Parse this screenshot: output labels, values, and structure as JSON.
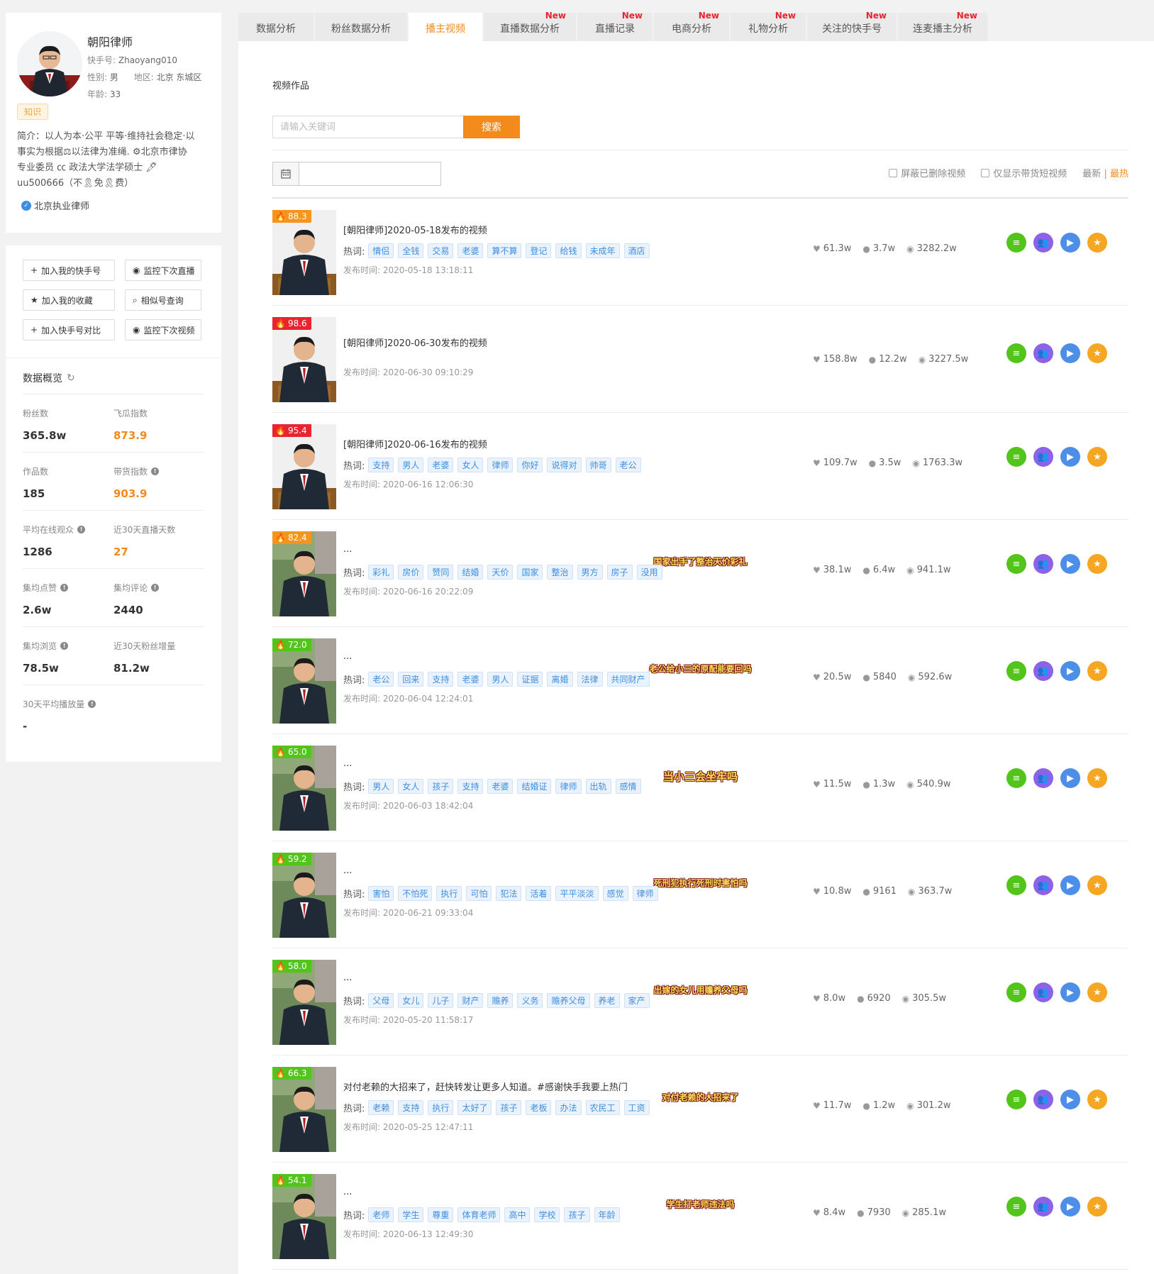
{
  "profile": {
    "name": "朝阳律师",
    "account_label": "快手号:",
    "account": "Zhaoyang010",
    "gender_label": "性别:",
    "gender": "男",
    "region_label": "地区:",
    "region": "北京 东城区",
    "age_label": "年龄:",
    "age": "33",
    "category": "知识",
    "bio_1": "简介：以人为本·公平 平等·维持社会稳定·以",
    "bio_2": "事实为根据⚖以法律为准绳. ⚙北京市律协",
    "bio_3": "专业委员 ㏄ 政法大学法学硕士 🖊",
    "bio_4": "uu500666（不🎗免🎗费）",
    "verified": "北京执业律师"
  },
  "actions": {
    "add_mine": "加入我的快手号",
    "monitor_live": "监控下次直播",
    "add_fav": "加入我的收藏",
    "similar": "相似号查询",
    "add_compare": "加入快手号对比",
    "monitor_video": "监控下次视频"
  },
  "overview": {
    "title": "数据概览",
    "fans_label": "粉丝数",
    "fans": "365.8w",
    "feigua_label": "飞瓜指数",
    "feigua": "873.9",
    "works_label": "作品数",
    "works": "185",
    "goods_label": "带货指数",
    "goods": "903.9",
    "online_label": "平均在线观众",
    "online": "1286",
    "livedays_label": "近30天直播天数",
    "livedays": "27",
    "avg_like_label": "集均点赞",
    "avg_like": "2.6w",
    "avg_comment_label": "集均评论",
    "avg_comment": "2440",
    "avg_view_label": "集均浏览",
    "avg_view": "78.5w",
    "fans_growth_label": "近30天粉丝增量",
    "fans_growth": "81.2w",
    "avg_play_label": "30天平均播放量",
    "avg_play": "-"
  },
  "tabs": [
    {
      "label": "数据分析",
      "new": ""
    },
    {
      "label": "粉丝数据分析",
      "new": ""
    },
    {
      "label": "播主视频",
      "new": ""
    },
    {
      "label": "直播数据分析",
      "new": "New"
    },
    {
      "label": "直播记录",
      "new": "New"
    },
    {
      "label": "电商分析",
      "new": "New"
    },
    {
      "label": "礼物分析",
      "new": "New"
    },
    {
      "label": "关注的快手号",
      "new": "New"
    },
    {
      "label": "连麦播主分析",
      "new": "New"
    }
  ],
  "main": {
    "section_title": "视频作品",
    "search_placeholder": "请输入关键词",
    "search_button": "搜索",
    "filter_deleted": "屏蔽已删除视频",
    "filter_goods": "仅显示带货短视频",
    "sort_latest": "最新",
    "sort_sep": "|",
    "sort_hot": "最热",
    "hot_label": "热词:",
    "time_label": "发布时间:"
  },
  "colors": {
    "accent": "#f28a1c",
    "score_orange": "#f7941d",
    "score_red": "#e8252e",
    "score_green": "#52c41a"
  },
  "videos": [
    {
      "score": "88.3",
      "title": "[朝阳律师]2020-05-18发布的视频",
      "tags": [
        "情侣",
        "全钱",
        "交易",
        "老婆",
        "算不算",
        "登记",
        "给钱",
        "未成年",
        "酒店"
      ],
      "time": "2020-05-18 13:18:11",
      "likes": "61.3w",
      "comments": "3.7w",
      "views": "3282.2w",
      "cover": ""
    },
    {
      "score": "98.6",
      "title": "[朝阳律师]2020-06-30发布的视频",
      "tags": [],
      "time": "2020-06-30 09:10:29",
      "likes": "158.8w",
      "comments": "12.2w",
      "views": "3227.5w",
      "cover": ""
    },
    {
      "score": "95.4",
      "title": "[朝阳律师]2020-06-16发布的视频",
      "tags": [
        "支持",
        "男人",
        "老婆",
        "女人",
        "律师",
        "你好",
        "说得对",
        "帅哥",
        "老公"
      ],
      "time": "2020-06-16 12:06:30",
      "likes": "109.7w",
      "comments": "3.5w",
      "views": "1763.3w",
      "cover": ""
    },
    {
      "score": "82.4",
      "title": "...",
      "tags": [
        "彩礼",
        "房价",
        "赞同",
        "结婚",
        "天价",
        "国家",
        "整治",
        "男方",
        "房子",
        "没用"
      ],
      "time": "2020-06-16 20:22:09",
      "likes": "38.1w",
      "comments": "6.4w",
      "views": "941.1w",
      "cover": "国家出手了整治天价彩礼"
    },
    {
      "score": "72.0",
      "title": "...",
      "tags": [
        "老公",
        "回来",
        "支持",
        "老婆",
        "男人",
        "证据",
        "离婚",
        "法律",
        "共同财产"
      ],
      "time": "2020-06-04 12:24:01",
      "likes": "20.5w",
      "comments": "5840",
      "views": "592.6w",
      "cover": "老公给小三的原配能要回吗"
    },
    {
      "score": "65.0",
      "title": "...",
      "tags": [
        "男人",
        "女人",
        "孩子",
        "支持",
        "老婆",
        "结婚证",
        "律师",
        "出轨",
        "感情"
      ],
      "time": "2020-06-03 18:42:04",
      "likes": "11.5w",
      "comments": "1.3w",
      "views": "540.9w",
      "cover": "当小三会坐牢吗"
    },
    {
      "score": "59.2",
      "title": "...",
      "tags": [
        "害怕",
        "不怕死",
        "执行",
        "可怕",
        "犯法",
        "活着",
        "平平淡淡",
        "感觉",
        "律师"
      ],
      "time": "2020-06-21 09:33:04",
      "likes": "10.8w",
      "comments": "9161",
      "views": "363.7w",
      "cover": "死刑犯执行死刑时害怕吗"
    },
    {
      "score": "58.0",
      "title": "...",
      "tags": [
        "父母",
        "女儿",
        "儿子",
        "财产",
        "赡养",
        "义务",
        "赡养父母",
        "养老",
        "家产"
      ],
      "time": "2020-05-20 11:58:17",
      "likes": "8.0w",
      "comments": "6920",
      "views": "305.5w",
      "cover": "出嫁的女儿用赡养父母吗"
    },
    {
      "score": "66.3",
      "title": "对付老赖的大招来了，赶快转发让更多人知道。#感谢快手我要上热门",
      "tags": [
        "老赖",
        "支持",
        "执行",
        "太好了",
        "孩子",
        "老板",
        "办法",
        "农民工",
        "工资"
      ],
      "time": "2020-05-25 12:47:11",
      "likes": "11.7w",
      "comments": "1.2w",
      "views": "301.2w",
      "cover": "对付老赖的大招来了"
    },
    {
      "score": "54.1",
      "title": "...",
      "tags": [
        "老师",
        "学生",
        "尊重",
        "体育老师",
        "高中",
        "学校",
        "孩子",
        "年龄"
      ],
      "time": "2020-06-13 12:49:30",
      "likes": "8.4w",
      "comments": "7930",
      "views": "285.1w",
      "cover": "学生打老师违法吗"
    }
  ]
}
